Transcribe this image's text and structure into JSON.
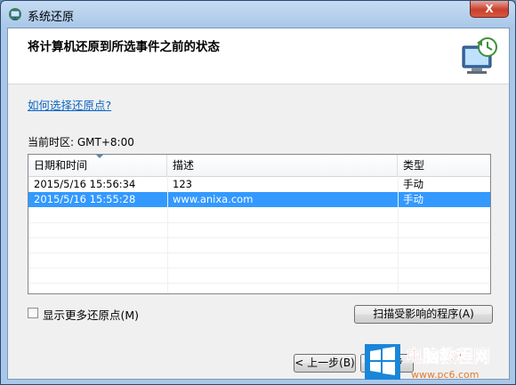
{
  "window": {
    "title": "系统还原",
    "close_label": "X"
  },
  "header": {
    "heading": "将计算机还原到所选事件之前的状态",
    "icon": "system-restore-monitor-icon"
  },
  "help_link": "如何选择还原点?",
  "timezone": "当前时区: GMT+8:00",
  "table": {
    "columns": [
      "日期和时间",
      "描述",
      "类型"
    ],
    "rows": [
      {
        "datetime": "2015/5/16 15:56:34",
        "description": "123",
        "type": "手动",
        "selected": false
      },
      {
        "datetime": "2015/5/16 15:55:28",
        "description": "www.anixa.com",
        "type": "手动",
        "selected": true
      }
    ]
  },
  "checkbox": {
    "label": "显示更多还原点(M)",
    "checked": false
  },
  "buttons": {
    "scan": "扫描受影响的程序(A)",
    "prev": "< 上一步(B)",
    "next": "下一步"
  },
  "watermark": {
    "text": "电脑教程网",
    "url": "www.pc6.com",
    "icon": "windows-logo-icon"
  },
  "colors": {
    "selection": "#3399ff",
    "link": "#0b66c2"
  }
}
